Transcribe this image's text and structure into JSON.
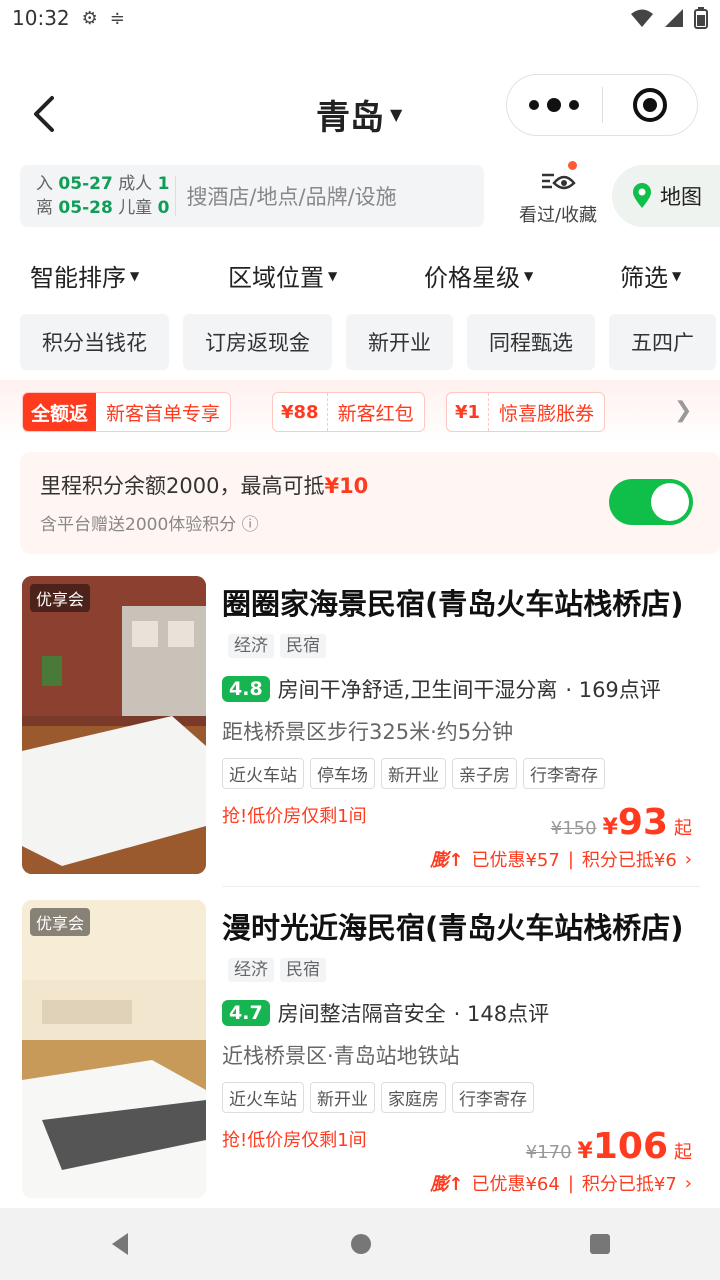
{
  "status": {
    "time": "10:32"
  },
  "header": {
    "city": "青岛"
  },
  "search": {
    "in_label": "入",
    "in_date": "05-27",
    "out_label": "离",
    "out_date": "05-28",
    "adult_label": "成人",
    "adult_count": "1",
    "child_label": "儿童",
    "child_count": "0",
    "placeholder": "搜酒店/地点/品牌/设施",
    "fav_label": "看过/收藏",
    "map_label": "地图"
  },
  "sort": [
    "智能排序",
    "区域位置",
    "价格星级",
    "筛选"
  ],
  "chips": [
    "积分当钱花",
    "订房返现金",
    "新开业",
    "同程甄选",
    "五四广"
  ],
  "promos": {
    "t1_a": "全额返",
    "t1_t": "新客首单专享",
    "t2_p": "¥88",
    "t2_t": "新客红包",
    "t3_p": "¥1",
    "t3_t": "惊喜膨胀券"
  },
  "mileage": {
    "line1": "里程积分余额2000，最高可抵",
    "line1_amount": "¥10",
    "line2": "含平台赠送2000体验积分",
    "toggle_on": true
  },
  "hotels": [
    {
      "badge": "优享会",
      "name": "圈圈家海景民宿(青岛火车站栈桥店)",
      "tag1": "经济",
      "tag2": "民宿",
      "score": "4.8",
      "review": "房间干净舒适,卫生间干湿分离",
      "count": "· 169点评",
      "distance": "距栈桥景区步行325米·约5分钟",
      "tags": [
        "近火车站",
        "停车场",
        "新开业",
        "亲子房",
        "行李寄存"
      ],
      "hot": "抢!低价房仅剩1间",
      "old_price": "¥150",
      "price_symbol": "¥",
      "price": "93",
      "qi": "起",
      "pz": "膨↑",
      "discount": "已优惠¥57",
      "points": "积分已抵¥6"
    },
    {
      "badge": "优享会",
      "name": "漫时光近海民宿(青岛火车站栈桥店)",
      "tag1": "经济",
      "tag2": "民宿",
      "score": "4.7",
      "review": "房间整洁隔音安全",
      "count": "· 148点评",
      "distance": "近栈桥景区·青岛站地铁站",
      "tags": [
        "近火车站",
        "新开业",
        "家庭房",
        "行李寄存"
      ],
      "hot": "抢!低价房仅剩1间",
      "old_price": "¥170",
      "price_symbol": "¥",
      "price": "106",
      "qi": "起",
      "pz": "膨↑",
      "discount": "已优惠¥64",
      "points": "积分已抵¥7"
    }
  ]
}
